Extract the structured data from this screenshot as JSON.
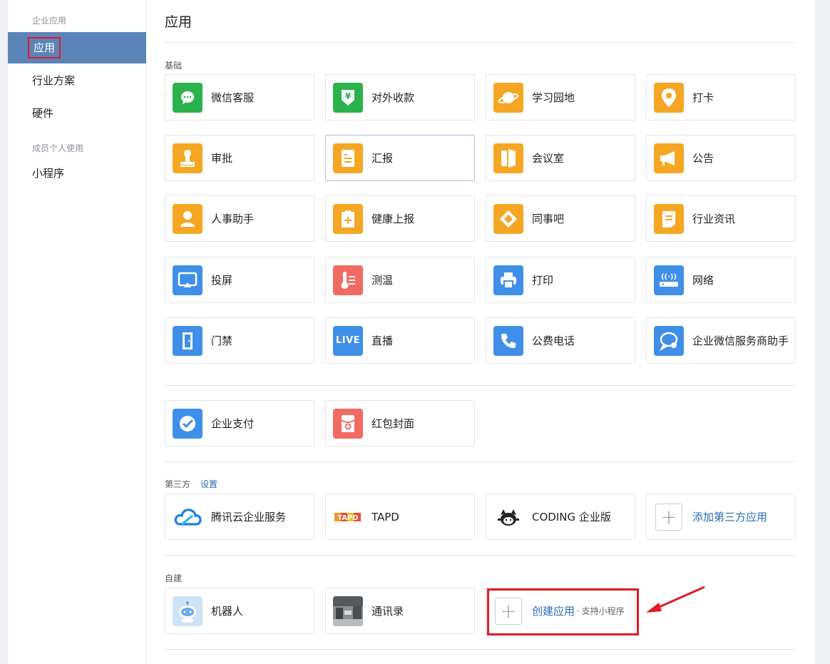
{
  "sidebar": {
    "section_enterprise": "企业应用",
    "items": [
      {
        "label": "应用"
      },
      {
        "label": "行业方案"
      },
      {
        "label": "硬件"
      }
    ],
    "section_personal": "成员个人使用",
    "personal_items": [
      {
        "label": "小程序"
      }
    ]
  },
  "main": {
    "title": "应用",
    "basic_label": "基础",
    "basic_apps": [
      {
        "label": "微信客服",
        "icon": "chat-bubble-icon",
        "color": "#2bb24c"
      },
      {
        "label": "对外收款",
        "icon": "yen-payment-icon",
        "color": "#2bb24c"
      },
      {
        "label": "学习园地",
        "icon": "planet-icon",
        "color": "#f5a623"
      },
      {
        "label": "打卡",
        "icon": "location-pin-icon",
        "color": "#f5a623"
      },
      {
        "label": "审批",
        "icon": "stamp-icon",
        "color": "#f5a623"
      },
      {
        "label": "汇报",
        "icon": "report-doc-icon",
        "color": "#f5a623"
      },
      {
        "label": "会议室",
        "icon": "door-icon",
        "color": "#f5a623"
      },
      {
        "label": "公告",
        "icon": "megaphone-icon",
        "color": "#f5a623"
      },
      {
        "label": "人事助手",
        "icon": "person-icon",
        "color": "#f5a623"
      },
      {
        "label": "健康上报",
        "icon": "health-clipboard-icon",
        "color": "#f5a623"
      },
      {
        "label": "同事吧",
        "icon": "diamond-icon",
        "color": "#f5a623"
      },
      {
        "label": "行业资讯",
        "icon": "news-doc-icon",
        "color": "#f5a623"
      },
      {
        "label": "投屏",
        "icon": "screen-cast-icon",
        "color": "#3f8fe8"
      },
      {
        "label": "测温",
        "icon": "thermometer-icon",
        "color": "#f26b63"
      },
      {
        "label": "打印",
        "icon": "printer-icon",
        "color": "#3f8fe8"
      },
      {
        "label": "网络",
        "icon": "wifi-router-icon",
        "color": "#3f8fe8"
      },
      {
        "label": "门禁",
        "icon": "access-door-icon",
        "color": "#3f8fe8"
      },
      {
        "label": "直播",
        "icon": "live-icon",
        "color": "#3f8fe8",
        "icon_text": "LIVE"
      },
      {
        "label": "公费电话",
        "icon": "phone-icon",
        "color": "#3f8fe8"
      },
      {
        "label": "企业微信服务商助手",
        "icon": "service-chat-icon",
        "color": "#3f8fe8"
      }
    ],
    "pay_apps": [
      {
        "label": "企业支付",
        "icon": "pay-check-icon",
        "color": "#3f8fe8"
      },
      {
        "label": "红包封面",
        "icon": "red-envelope-icon",
        "color": "#f26b63"
      }
    ],
    "third_party_label": "第三方",
    "third_party_settings": "设置",
    "third_party_apps": [
      {
        "label": "腾讯云企业服务",
        "icon": "tencent-cloud-icon"
      },
      {
        "label": "TAPD",
        "icon": "tapd-logo-icon"
      },
      {
        "label": "CODING 企业版",
        "icon": "coding-logo-icon"
      },
      {
        "label": "添加第三方应用",
        "icon": "plus-icon"
      }
    ],
    "custom_label": "自建",
    "custom_apps": [
      {
        "label": "机器人",
        "icon": "robot-icon"
      },
      {
        "label": "通讯录",
        "icon": "contacts-photo-icon"
      }
    ],
    "create_app": {
      "label": "创建应用",
      "sub": "· 支持小程序"
    }
  },
  "colors": {
    "accent": "#5b84b9",
    "highlight": "#e01b24",
    "link": "#2c6cb0"
  }
}
